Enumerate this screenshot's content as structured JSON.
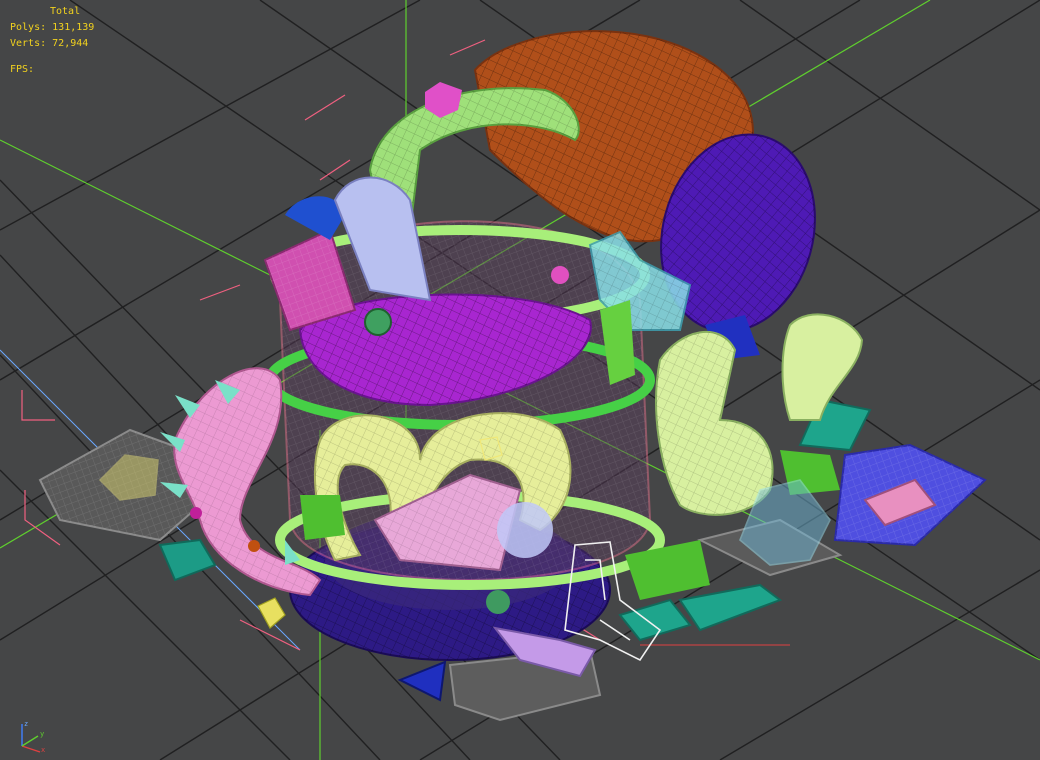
{
  "stats": {
    "title": "Total",
    "polys_label": "Polys:",
    "polys_value": "131,139",
    "verts_label": "Verts:",
    "verts_value": "72,944",
    "fps_label": "FPS:"
  },
  "axis_gizmo": {
    "x_label": "x",
    "y_label": "y",
    "z_label": "z"
  },
  "colors": {
    "background": "#454647",
    "grid_line": "#202020",
    "stats_text": "#f2d21e",
    "axis_green": "#5fcf2e",
    "axis_red": "#e04040",
    "axis_blue": "#4080ff"
  }
}
